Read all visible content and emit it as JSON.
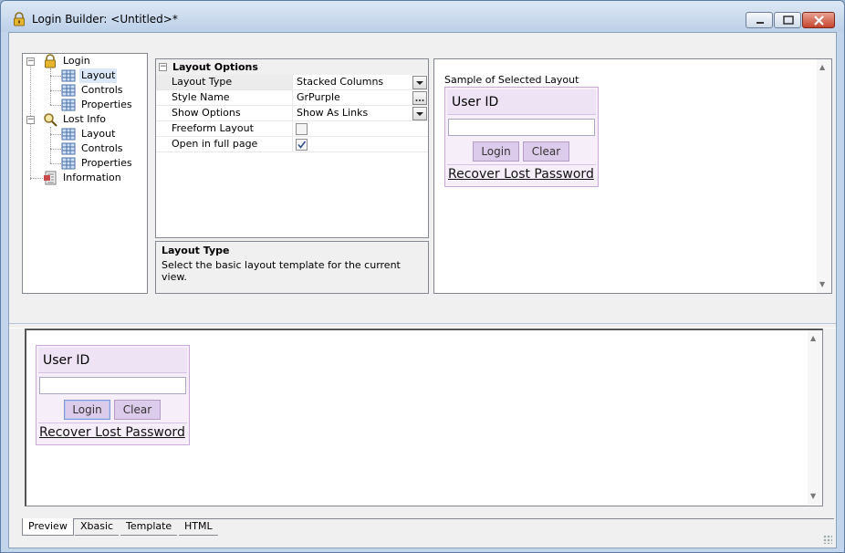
{
  "window": {
    "title": "Login Builder: <Untitled>*",
    "icon": "lock-icon",
    "controls": [
      "minimize-icon",
      "maximize-icon",
      "close-icon"
    ]
  },
  "tree": {
    "items": [
      {
        "label": "Login",
        "icon": "lock-icon",
        "level": 0
      },
      {
        "label": "Layout",
        "icon": "grid-icon",
        "level": 1,
        "selected": true
      },
      {
        "label": "Controls",
        "icon": "grid-icon",
        "level": 1
      },
      {
        "label": "Properties",
        "icon": "grid-icon",
        "level": 1
      },
      {
        "label": "Lost Info",
        "icon": "search-icon",
        "level": 0
      },
      {
        "label": "Layout",
        "icon": "grid-icon",
        "level": 1
      },
      {
        "label": "Controls",
        "icon": "grid-icon",
        "level": 1
      },
      {
        "label": "Properties",
        "icon": "grid-icon",
        "level": 1
      },
      {
        "label": "Information",
        "icon": "info-icon",
        "level": 0
      }
    ]
  },
  "property_grid": {
    "category": "Layout Options",
    "rows": [
      {
        "name": "Layout Type",
        "value": "Stacked Columns",
        "editor": "dropdown"
      },
      {
        "name": "Style Name",
        "value": "GrPurple",
        "editor": "ellipsis"
      },
      {
        "name": "Show Options",
        "value": "Show As Links",
        "editor": "dropdown"
      },
      {
        "name": "Freeform Layout",
        "value": "",
        "editor": "checkbox",
        "checked": false
      },
      {
        "name": "Open in full page",
        "value": "",
        "editor": "checkbox",
        "checked": true
      }
    ],
    "description": {
      "title": "Layout Type",
      "text": "Select the basic layout template for the current view."
    }
  },
  "sample": {
    "caption": "Sample of Selected Layout",
    "form": {
      "header": "User ID",
      "login_label": "Login",
      "clear_label": "Clear",
      "link": "Recover Lost Password"
    }
  },
  "preview": {
    "form": {
      "header": "User ID",
      "login_label": "Login",
      "clear_label": "Clear",
      "link": "Recover Lost Password"
    }
  },
  "tabs": [
    "Preview",
    "Xbasic",
    "Template",
    "HTML"
  ],
  "active_tab": "Preview",
  "colors": {
    "form_bg": "#f6effa",
    "form_border": "#c9a9d9",
    "button_bg": "#dccbea"
  }
}
